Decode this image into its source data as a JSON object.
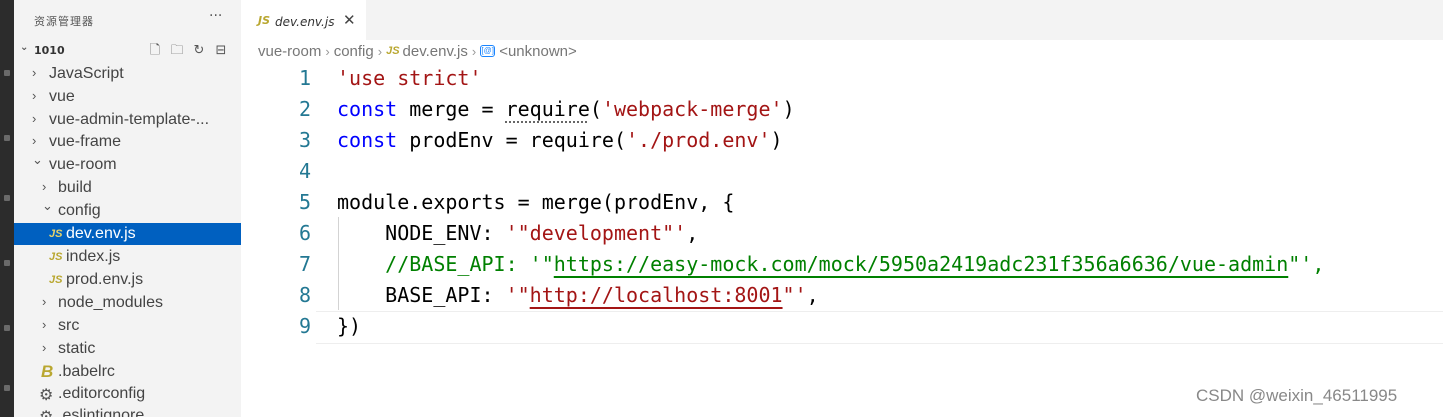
{
  "sidebar": {
    "title": "资源管理器",
    "more": "···",
    "folder": "1010",
    "actions": [
      "new-file",
      "new-folder",
      "refresh",
      "collapse-all"
    ],
    "items": [
      {
        "label": "JavaScript",
        "chev": "›"
      },
      {
        "label": "vue",
        "chev": "›"
      },
      {
        "label": "vue-admin-template-...",
        "chev": "›"
      },
      {
        "label": "vue-frame",
        "chev": "›"
      },
      {
        "label": "vue-room",
        "chev": "⌄"
      },
      {
        "label": "build",
        "chev": "›"
      },
      {
        "label": "config",
        "chev": "⌄"
      },
      {
        "label": "dev.env.js",
        "icon": "JS"
      },
      {
        "label": "index.js",
        "icon": "JS"
      },
      {
        "label": "prod.env.js",
        "icon": "JS"
      },
      {
        "label": "node_modules",
        "chev": "›"
      },
      {
        "label": "src",
        "chev": "›"
      },
      {
        "label": "static",
        "chev": "›"
      },
      {
        "label": ".babelrc",
        "icon": "B"
      },
      {
        "label": ".editorconfig",
        "icon": "⚙"
      },
      {
        "label": ".eslintignore",
        "icon": "⚙"
      }
    ]
  },
  "tab": {
    "icon": "JS",
    "label": "dev.env.js",
    "close": "✕"
  },
  "breadcrumb": {
    "parts": [
      "vue-room",
      "config",
      "dev.env.js",
      "<unknown>"
    ],
    "sep": "›",
    "js_icon": "JS"
  },
  "code": {
    "line_numbers": [
      "1",
      "2",
      "3",
      "4",
      "5",
      "6",
      "7",
      "8",
      "9"
    ],
    "l1": "'use strict'",
    "l2_kw": "const",
    "l2_a": " merge = ",
    "l2_req": "require",
    "l2_b": "(",
    "l2_str": "'webpack-merge'",
    "l2_c": ")",
    "l3_kw": "const",
    "l3_a": " prodEnv = require(",
    "l3_str": "'./prod.env'",
    "l3_b": ")",
    "l5": "module.exports = merge(prodEnv, {",
    "l6_a": "    NODE_ENV: ",
    "l6_str": "'\"development\"'",
    "l6_b": ",",
    "l7_a": "    //BASE_API: '\"",
    "l7_url": "https://easy-mock.com/mock/5950a2419adc231f356a6636/vue-admin",
    "l7_b": "\"',",
    "l8_a": "    BASE_API: ",
    "l8_s1": "'\"",
    "l8_url": "http://localhost:8001",
    "l8_s2": "\"'",
    "l8_b": ",",
    "l9": "})"
  },
  "watermark": "CSDN @weixin_46511995"
}
